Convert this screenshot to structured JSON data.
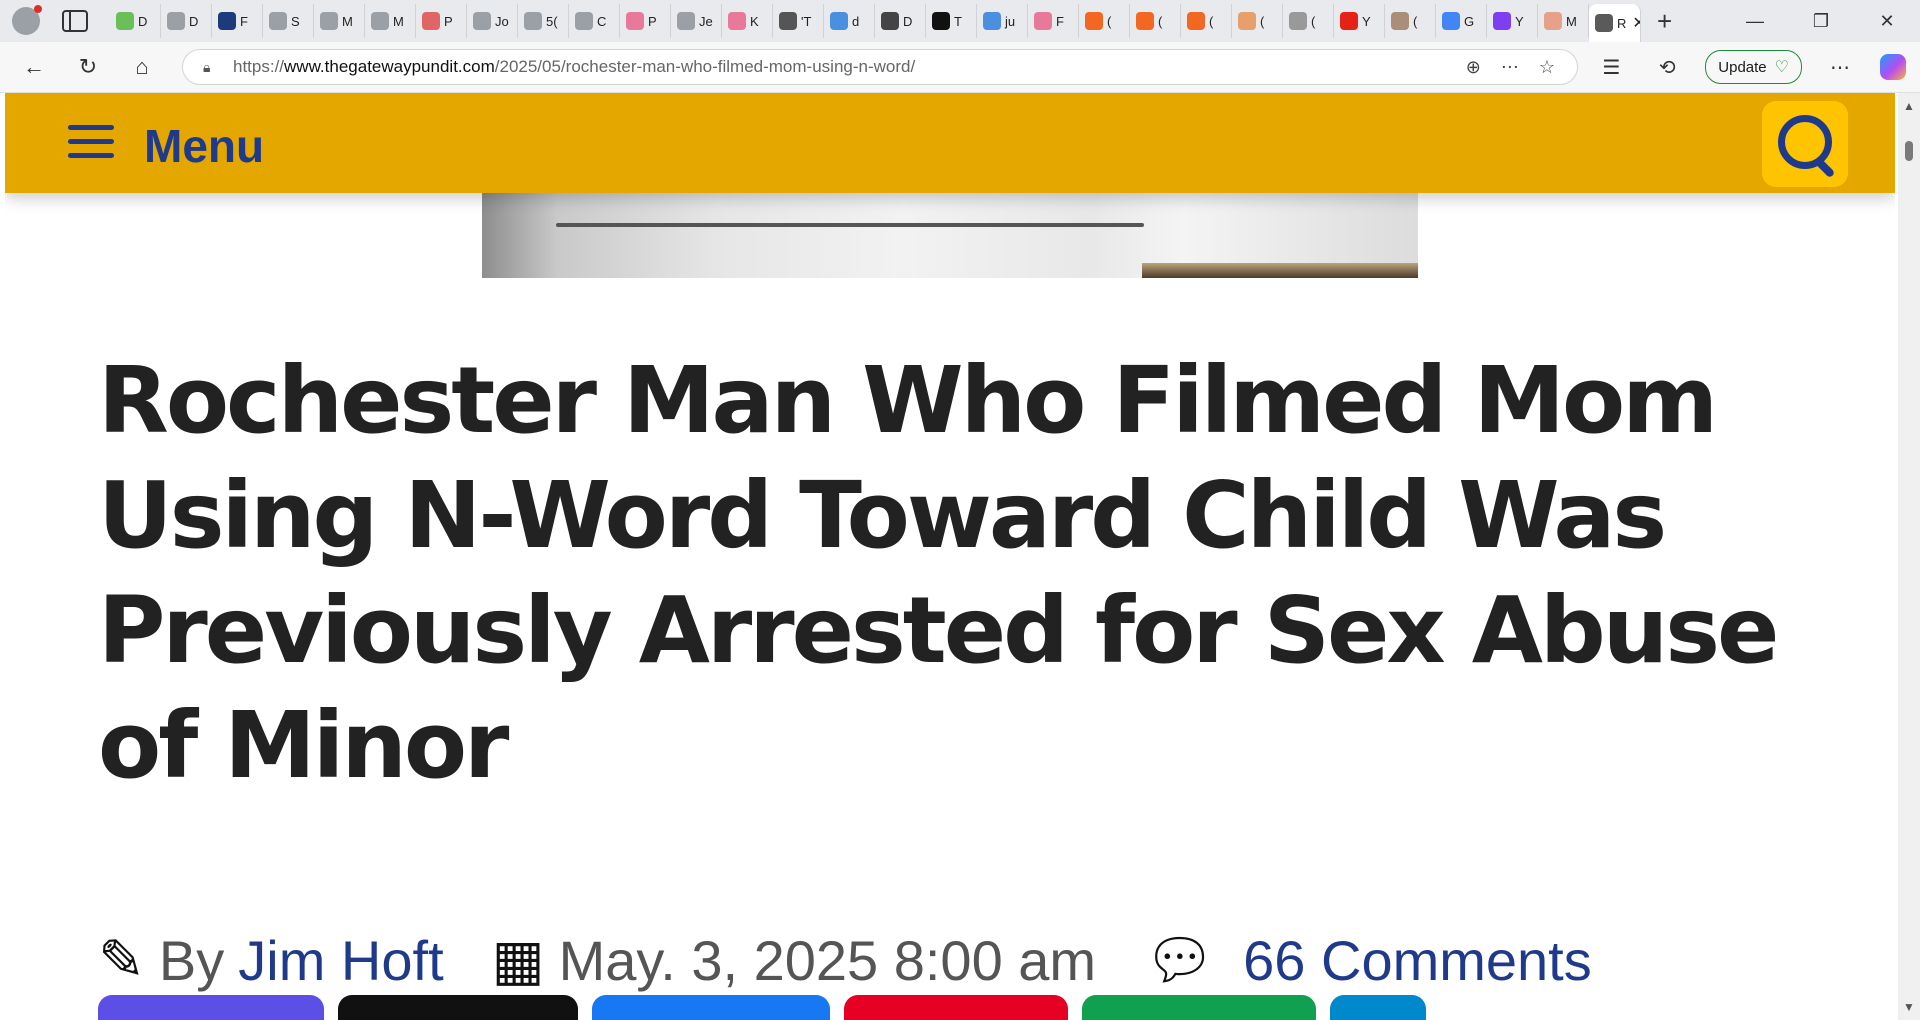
{
  "browser": {
    "tabs": [
      {
        "label": "D",
        "color": "#6bbf59"
      },
      {
        "label": "D",
        "color": "#9aa0a6"
      },
      {
        "label": "F",
        "color": "#1c3b7a"
      },
      {
        "label": "S",
        "color": "#9aa0a6"
      },
      {
        "label": "M",
        "color": "#9aa0a6"
      },
      {
        "label": "M",
        "color": "#9aa0a6"
      },
      {
        "label": "P",
        "color": "#e06666"
      },
      {
        "label": "Jo",
        "color": "#9aa0a6"
      },
      {
        "label": "5(",
        "color": "#9aa0a6"
      },
      {
        "label": "C",
        "color": "#9aa0a6"
      },
      {
        "label": "P",
        "color": "#e8799a"
      },
      {
        "label": "Je",
        "color": "#9aa0a6"
      },
      {
        "label": "K",
        "color": "#e8799a"
      },
      {
        "label": "'T",
        "color": "#555555"
      },
      {
        "label": "d",
        "color": "#4a8fe0"
      },
      {
        "label": "D",
        "color": "#444444"
      },
      {
        "label": "T",
        "color": "#111111"
      },
      {
        "label": "ju",
        "color": "#4a8fe0"
      },
      {
        "label": "F",
        "color": "#e8799a"
      },
      {
        "label": "(",
        "color": "#f26722"
      },
      {
        "label": "(",
        "color": "#f26722"
      },
      {
        "label": "(",
        "color": "#f26722"
      },
      {
        "label": "(",
        "color": "#e7a06b"
      },
      {
        "label": "(",
        "color": "#999999"
      },
      {
        "label": "Y",
        "color": "#e62117"
      },
      {
        "label": "(",
        "color": "#a98f7a"
      },
      {
        "label": "G",
        "color": "#4285f4"
      },
      {
        "label": "Y",
        "color": "#7e3ff2"
      },
      {
        "label": "M",
        "color": "#e7a08a"
      }
    ],
    "active_tab": {
      "label": "R",
      "close": "✕",
      "color": "#5a5a5a"
    },
    "new_tab": "+",
    "window_controls": {
      "minimize": "—",
      "restore": "❐",
      "close": "✕"
    },
    "url_prefix": "https://",
    "url_domain": "www.thegatewaypundit.com",
    "url_path": "/2025/05/rochester-man-who-filmed-mom-using-n-word/",
    "update_label": "Update",
    "icons": {
      "back": "back-icon",
      "reload": "reload-icon",
      "home": "home-icon",
      "lock": "lock-icon"
    }
  },
  "site": {
    "menu_label": "Menu",
    "accent": "#e3a700",
    "nav_color": "#1f3a8a"
  },
  "article": {
    "title": "Rochester Man Who Filmed Mom Using N-Word Toward Child Was Previously Arrested for Sex Abuse of Minor",
    "by": "By",
    "author": "Jim Hoft",
    "date": "May. 3, 2025 8:00 am",
    "comments": "66 Comments"
  },
  "share_buttons": [
    {
      "name": "share-button-1",
      "color": "#5b4fe6"
    },
    {
      "name": "share-button-2",
      "color": "#111111"
    },
    {
      "name": "share-button-3",
      "color": "#1877f2"
    },
    {
      "name": "share-button-4",
      "color": "#e60023"
    },
    {
      "name": "share-button-5",
      "color": "#10a050"
    },
    {
      "name": "share-button-6",
      "color": "#0088cc"
    }
  ]
}
